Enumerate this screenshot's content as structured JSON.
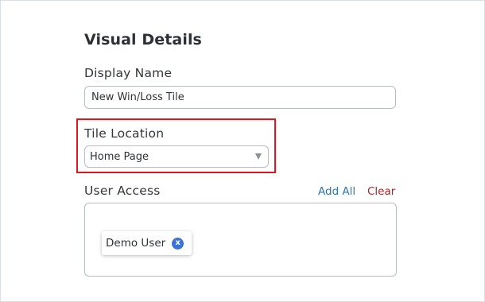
{
  "visual_details": {
    "title": "Visual Details",
    "display_name": {
      "label": "Display Name",
      "value": "New Win/Loss Tile"
    },
    "tile_location": {
      "label": "Tile Location",
      "selected": "Home Page"
    },
    "user_access": {
      "label": "User Access",
      "add_all_label": "Add All",
      "clear_label": "Clear",
      "users": [
        {
          "name": "Demo User",
          "remove_glyph": "x"
        }
      ]
    }
  },
  "colors": {
    "highlight": "#e0161e",
    "add_all": "#2a76b8",
    "clear": "#b52127",
    "chip_remove": "#3b74d8"
  }
}
